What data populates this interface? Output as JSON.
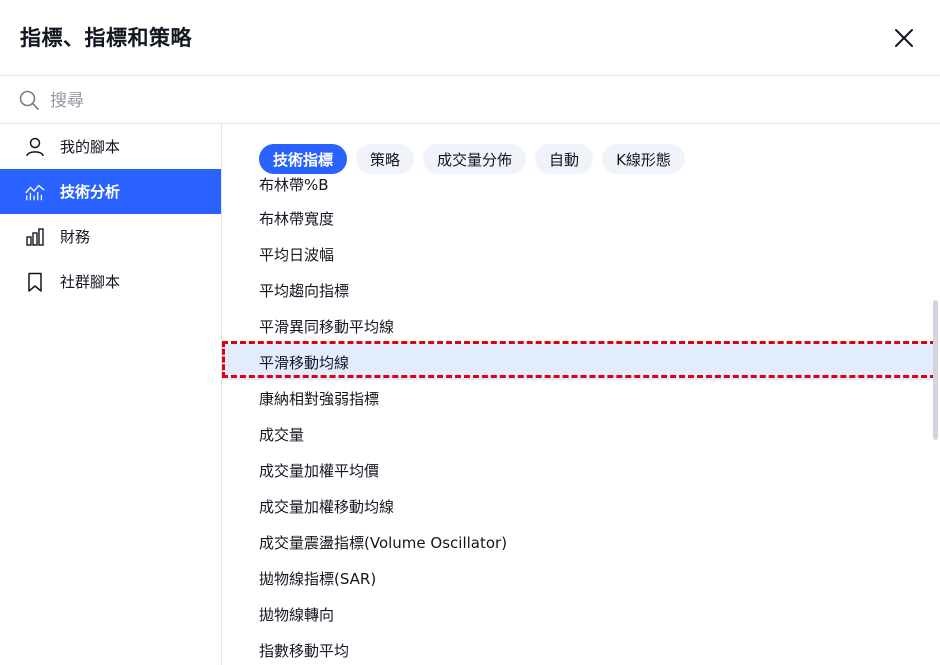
{
  "header": {
    "title": "指標、指標和策略"
  },
  "search": {
    "placeholder": "搜尋",
    "value": ""
  },
  "sidebar": {
    "items": [
      {
        "label": "我的腳本",
        "icon": "user-icon"
      },
      {
        "label": "技術分析",
        "icon": "chart-line-icon",
        "active": true
      },
      {
        "label": "財務",
        "icon": "bar-chart-icon"
      },
      {
        "label": "社群腳本",
        "icon": "bookmark-icon"
      }
    ]
  },
  "tabs": [
    {
      "label": "技術指標",
      "active": true
    },
    {
      "label": "策略"
    },
    {
      "label": "成交量分佈"
    },
    {
      "label": "自動"
    },
    {
      "label": "K線形態"
    }
  ],
  "list": {
    "items": [
      "布林帶%B",
      "布林帶寬度",
      "平均日波幅",
      "平均趨向指標",
      "平滑異同移動平均線",
      "平滑移動均線",
      "康納相對強弱指標",
      "成交量",
      "成交量加權平均價",
      "成交量加權移動均線",
      "成交量震盪指標(Volume Oscillator)",
      "拋物線指標(SAR)",
      "拋物線轉向",
      "指數移動平均"
    ],
    "selected_index": 5
  },
  "colors": {
    "accent": "#2962ff",
    "highlight": "#e0000b",
    "selected_bg": "#e3ecfd"
  }
}
